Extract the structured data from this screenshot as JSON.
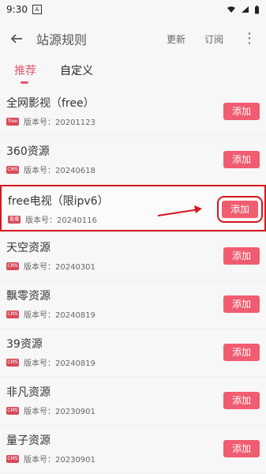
{
  "status": {
    "time": "9:30",
    "notify_icon": "A"
  },
  "app_bar": {
    "title": "站源规则",
    "update": "更新",
    "subscribe": "订阅",
    "more": "⋮"
  },
  "tabs": [
    {
      "label": "推荐"
    },
    {
      "label": "自定义"
    }
  ],
  "items": [
    {
      "name": "全网影视（free）",
      "badge": "free",
      "version": "版本号：20201123",
      "action": "添加"
    },
    {
      "name": "360资源",
      "badge": "CMS",
      "version": "版本号：20240618",
      "action": "添加"
    },
    {
      "name": "free电视（限ipv6）",
      "badge": "直播",
      "version": "版本号：20240116",
      "action": "添加"
    },
    {
      "name": "天空资源",
      "badge": "CMS",
      "version": "版本号：20240301",
      "action": "添加"
    },
    {
      "name": "飘零资源",
      "badge": "CMS",
      "version": "版本号：20240819",
      "action": "添加"
    },
    {
      "name": "39资源",
      "badge": "CMS",
      "version": "版本号：20240819",
      "action": "添加"
    },
    {
      "name": "非凡资源",
      "badge": "CMS",
      "version": "版本号：20230901",
      "action": "添加"
    },
    {
      "name": "量子资源",
      "badge": "CMS",
      "version": "版本号：20230901",
      "action": "添加"
    }
  ],
  "colors": {
    "accent": "#e2566e",
    "button": "#f05c70",
    "annotation": "#d5151d"
  }
}
